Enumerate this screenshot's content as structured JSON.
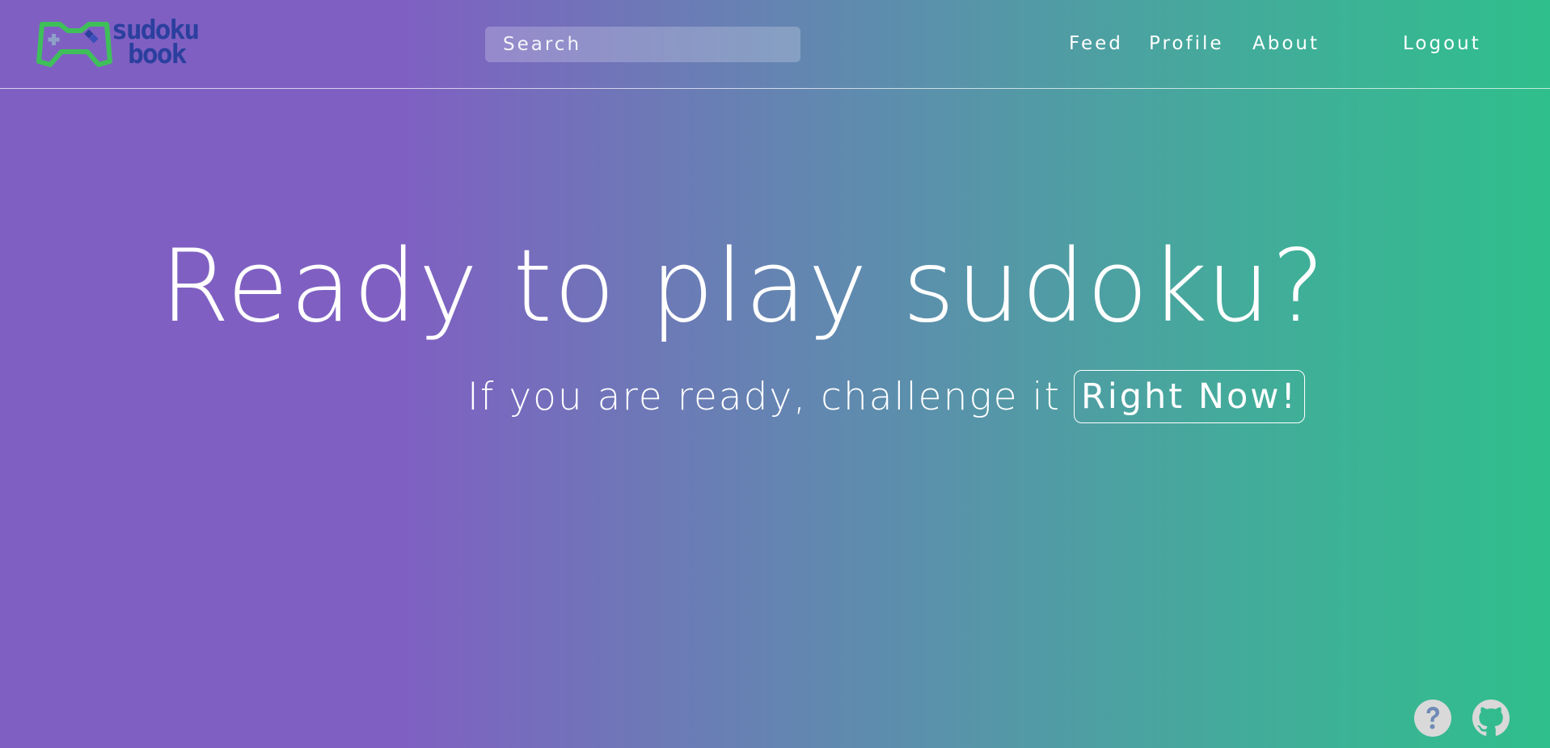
{
  "header": {
    "logo": {
      "text_line1": "sudoku",
      "text_line2": "book",
      "icon": "gamepad-icon"
    },
    "search": {
      "placeholder": "Search"
    },
    "nav": {
      "feed": "Feed",
      "profile": "Profile",
      "about": "About",
      "logout": "Logout"
    }
  },
  "hero": {
    "title": "Ready to play sudoku?",
    "subtitle": "If you are ready, challenge it",
    "cta_label": "Right Now!"
  },
  "footer": {
    "icons": [
      "help-icon",
      "github-icon"
    ]
  },
  "colors": {
    "gradient_start": "#7f60c2",
    "gradient_end": "#2fbf8c",
    "logo_green": "#3fbf5a",
    "logo_blue": "#2b3f9e",
    "icon_gray": "#d9d9d9"
  }
}
